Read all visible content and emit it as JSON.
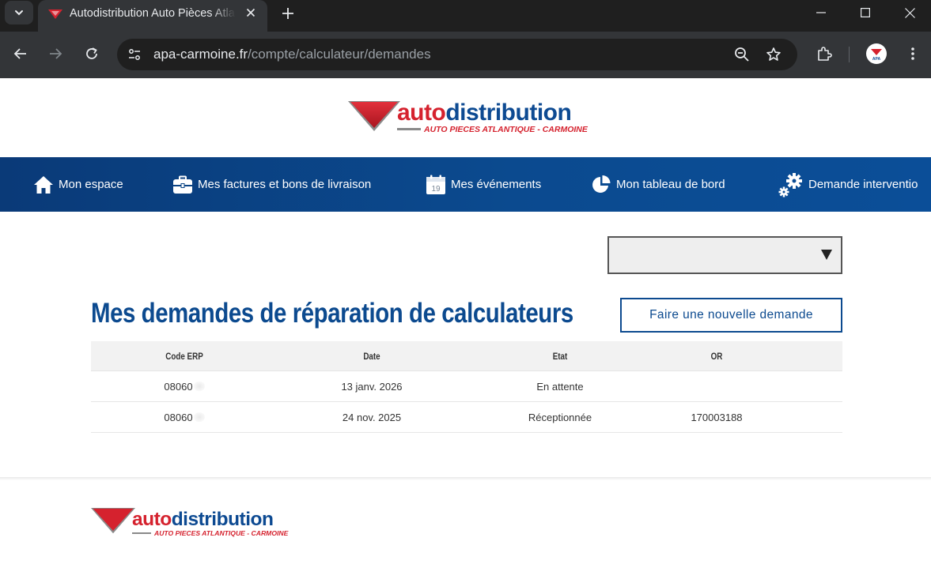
{
  "browser": {
    "tab_title": "Autodistribution Auto Pièces Atlantique - Carmoine",
    "url_host": "apa-carmoine.fr",
    "url_path": "/compte/calculateur/demandes"
  },
  "brand": {
    "word_auto": "auto",
    "word_distribution": "distribution",
    "tagline": "AUTO PIECES ATLANTIQUE - CARMOINE",
    "colors": {
      "red": "#d5222e",
      "blue": "#0d4a92"
    }
  },
  "nav": {
    "items": [
      {
        "label": "Mon espace",
        "icon": "home-icon"
      },
      {
        "label": "Mes factures et bons de livraison",
        "icon": "briefcase-icon"
      },
      {
        "label": "Mes événements",
        "icon": "calendar-icon",
        "calendar_day": "19"
      },
      {
        "label": "Mon tableau de bord",
        "icon": "pie-chart-icon"
      },
      {
        "label": "Demande interventio",
        "icon": "gears-icon"
      }
    ]
  },
  "main": {
    "select_value": "",
    "title": "Mes demandes de réparation de calculateurs",
    "new_request_label": "Faire une nouvelle demande",
    "table": {
      "headers": [
        "Code ERP",
        "Date",
        "Etat",
        "OR"
      ],
      "rows": [
        {
          "code": "08060",
          "date": "13 janv. 2026",
          "etat": "En attente",
          "or": ""
        },
        {
          "code": "08060",
          "date": "24 nov. 2025",
          "etat": "Réceptionnée",
          "or": "170003188"
        }
      ]
    }
  }
}
